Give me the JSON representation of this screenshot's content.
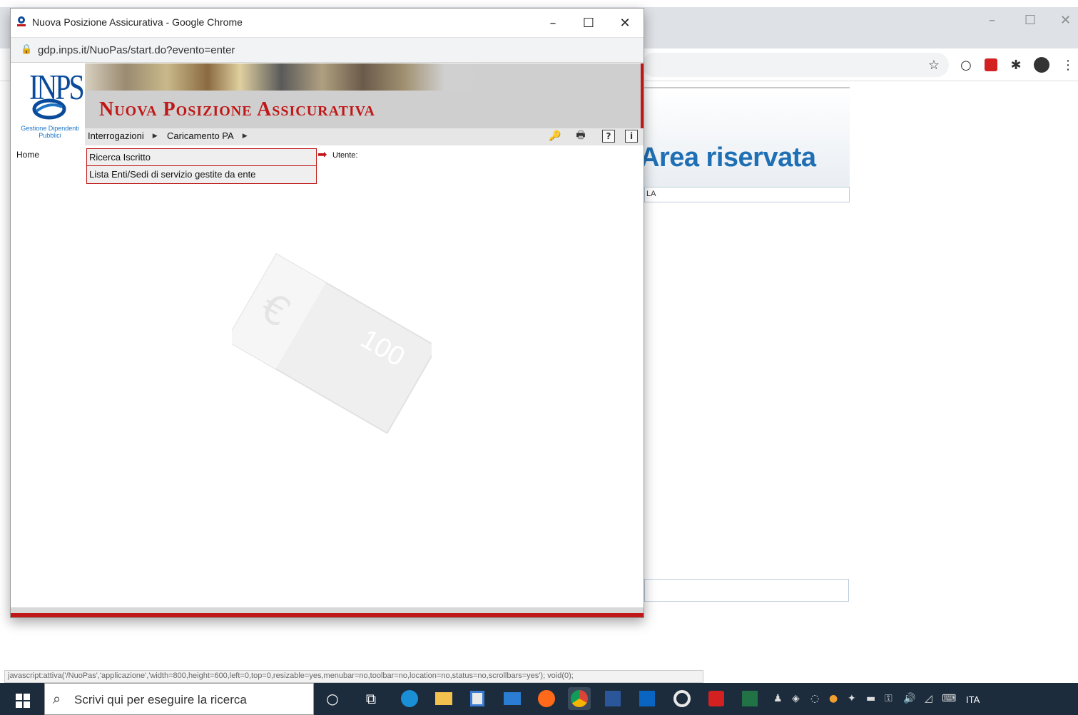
{
  "background_window": {
    "area_title": "Area riservata",
    "input_fragment": "LA",
    "status_text": "javascript:attiva('/NuoPas','applicazione','width=800,height=600,left=0,top=0,resizable=yes,menubar=no,toolbar=no,location=no,status=no,scrollbars=yes'); void(0);",
    "controls": {
      "minimize": "–",
      "maximize": "☐",
      "close": "✕"
    },
    "toolbar_icons": [
      "star-icon",
      "opera-icon",
      "acrobat-icon",
      "extensions-icon",
      "profile-icon",
      "menu-icon"
    ]
  },
  "popup": {
    "window_title": "Nuova Posizione Assicurativa - Google Chrome",
    "url": "gdp.inps.it/NuoPas/start.do?evento=enter",
    "controls": {
      "minimize": "–",
      "maximize": "☐",
      "close": "✕"
    }
  },
  "app": {
    "logo_text": "INPS",
    "logo_caption": "Gestione Dipendenti Pubblici",
    "title": "Nuova Posizione Assicurativa",
    "menu": [
      {
        "label": "Interrogazioni",
        "arrow": "▶"
      },
      {
        "label": "Caricamento PA",
        "arrow": "▶"
      }
    ],
    "header_icons": {
      "key": "🔑",
      "print": "🖶",
      "help": "?",
      "info": "i"
    },
    "home": "Home",
    "dropdown": [
      "Ricerca Iscritto",
      "Lista Enti/Sedi di servizio gestite da ente"
    ],
    "arrow": "➡",
    "user_label": "Utente:",
    "watermark_value": "100"
  },
  "taskbar": {
    "search_placeholder": "Scrivi qui per eseguire la ricerca",
    "language": "ITA",
    "apps": [
      "cortana-icon",
      "task-view-icon",
      "edge-icon",
      "file-explorer-icon",
      "store-icon",
      "mail-icon",
      "firefox-icon",
      "chrome-icon",
      "word-icon",
      "outlook-icon",
      "google-icon",
      "acrobat-icon",
      "excel-icon"
    ]
  }
}
